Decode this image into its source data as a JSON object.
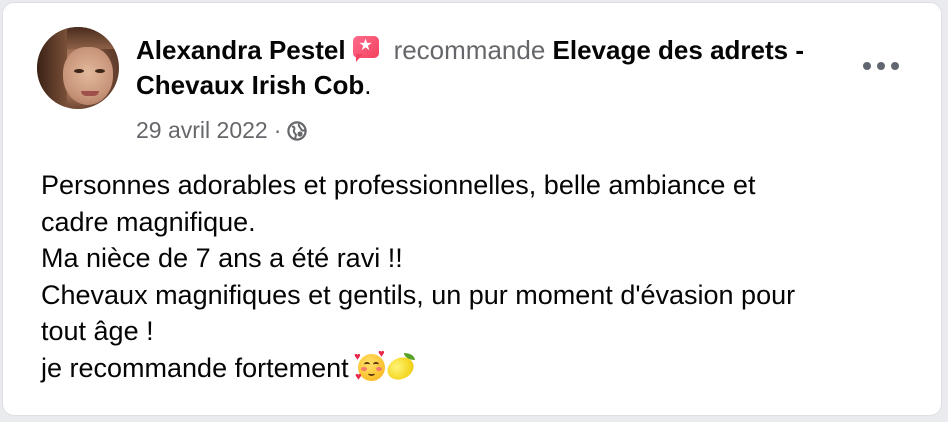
{
  "post": {
    "author": "Alexandra Pestel",
    "verb": "recommande",
    "page_name": "Elevage des adrets - Chevaux Irish Cob",
    "period": ".",
    "date": "29 avril 2022",
    "separator": "·",
    "audience_icon": "globe-icon",
    "recommend_icon": "recommend-star-icon",
    "more_icon": "more-options-icon",
    "body_lines": [
      "Personnes adorables et professionnelles, belle ambiance et",
      "cadre magnifique.",
      "Ma nièce de 7 ans a été ravi !!",
      "Chevaux magnifiques et gentils, un pur moment d'évasion pour",
      "tout âge !",
      "je recommande fortement"
    ],
    "emojis": [
      "smiling-face-with-hearts",
      "lemon"
    ]
  },
  "colors": {
    "text_primary": "#050505",
    "text_secondary": "#65676b",
    "recommend_accent": "#f3425f",
    "card_background": "#ffffff"
  }
}
